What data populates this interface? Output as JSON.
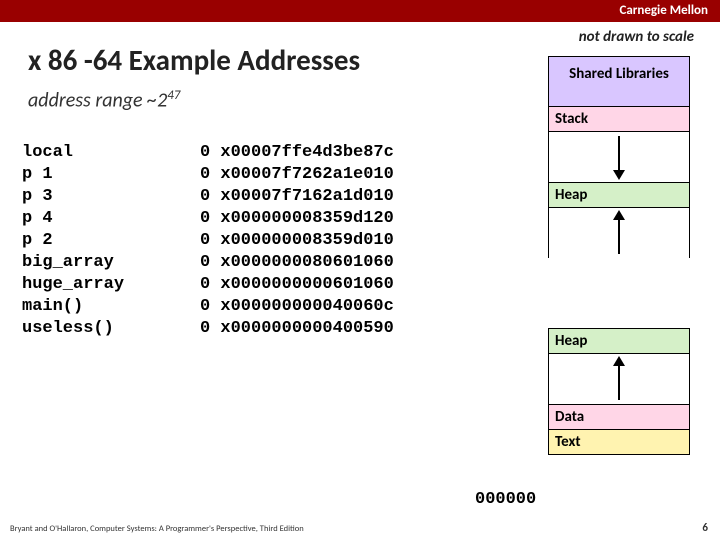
{
  "header": {
    "brand": "Carnegie Mellon"
  },
  "title": "x 86 -64 Example Addresses",
  "subtitle_prefix": "address range ~2",
  "subtitle_exp": "47",
  "not_drawn": "not drawn to scale",
  "names": [
    "local",
    "p 1",
    "p 3",
    "p 4",
    "p 2",
    "big_array",
    "huge_array",
    "main()",
    "useless()"
  ],
  "addresses": [
    "0 x00007ffe4d3be87c",
    "0 x00007f7262a1e010",
    "0 x00007f7162a1d010",
    "0 x000000008359d120",
    "0 x000000008359d010",
    "0 x0000000080601060",
    "0 x0000000000601060",
    "0 x000000000040060c",
    "0 x0000000000400590"
  ],
  "mem": {
    "shared": "Shared Libraries",
    "stack": "Stack",
    "heap1": "Heap",
    "heap2": "Heap",
    "data": "Data",
    "text": "Text"
  },
  "zeros": "000000",
  "footer": "Bryant and O'Hallaron, Computer Systems: A Programmer's Perspective, Third Edition",
  "page": "6"
}
